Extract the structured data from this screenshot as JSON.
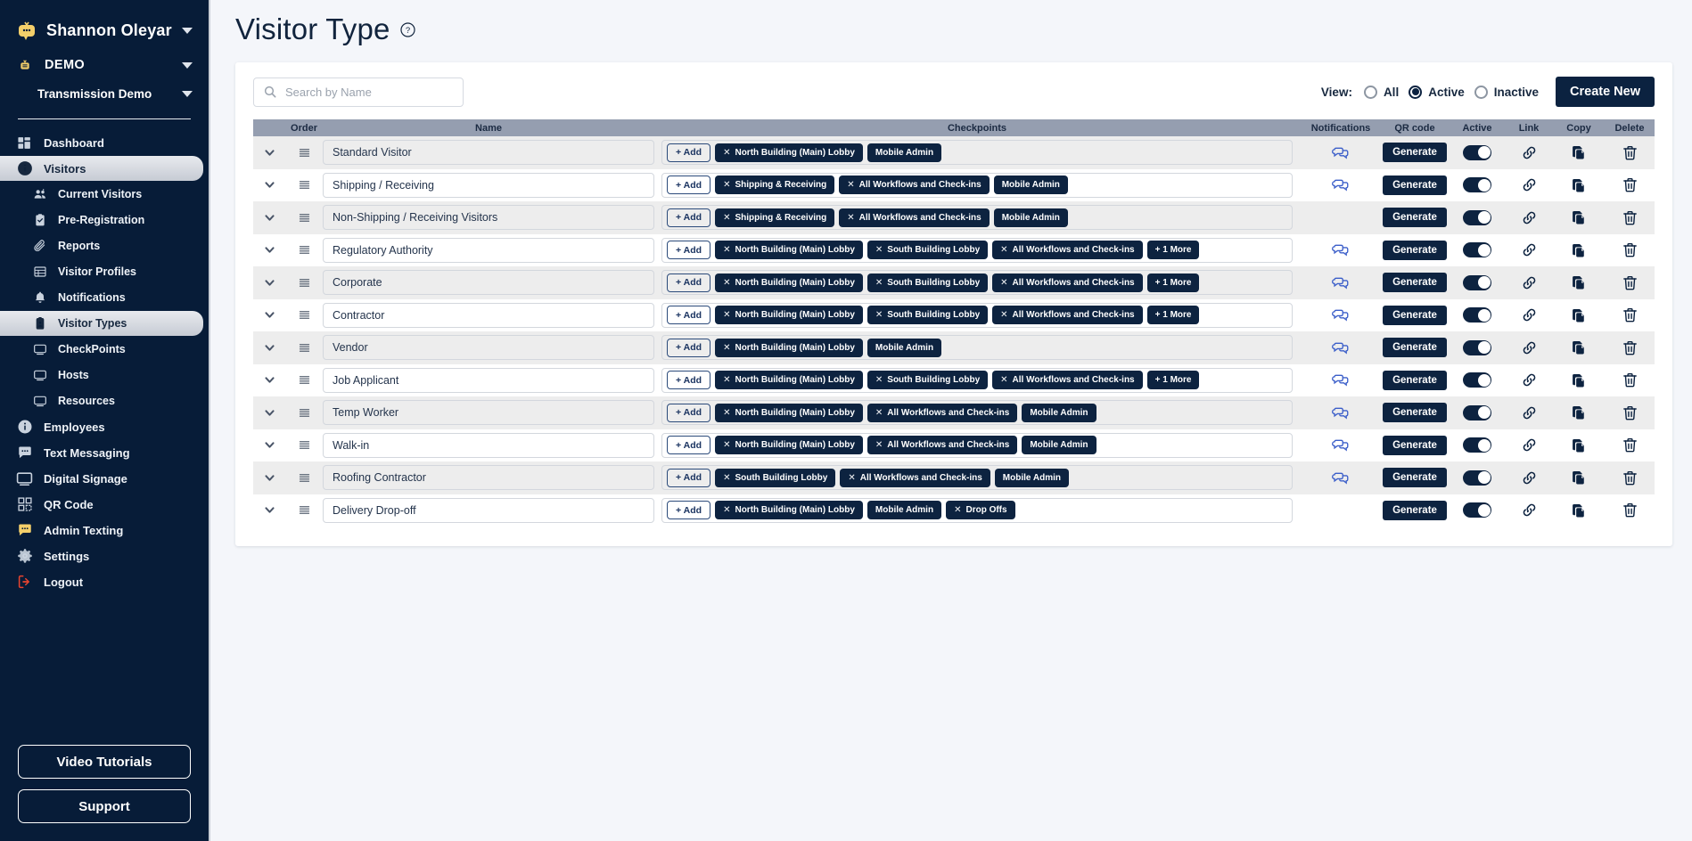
{
  "sidebar": {
    "user": {
      "name": "Shannon Oleyar",
      "icon": "tv-chat-logo-icon",
      "caret": "chevron-down-icon"
    },
    "org": {
      "name": "DEMO",
      "icon": "tv-small-icon"
    },
    "sub_org": {
      "name": "Transmission Demo"
    },
    "items": [
      {
        "label": "Dashboard",
        "icon": "dashboard-icon",
        "level": "top",
        "active": false
      },
      {
        "label": "Visitors",
        "icon": "info-circle-icon",
        "level": "top",
        "active": true
      },
      {
        "label": "Current Visitors",
        "icon": "people-icon",
        "level": "sub",
        "active": false
      },
      {
        "label": "Pre-Registration",
        "icon": "clipboard-check-icon",
        "level": "sub",
        "active": false
      },
      {
        "label": "Reports",
        "icon": "paperclip-icon",
        "level": "sub",
        "active": false
      },
      {
        "label": "Visitor Profiles",
        "icon": "table-icon",
        "level": "sub",
        "active": false
      },
      {
        "label": "Notifications",
        "icon": "bell-icon",
        "level": "sub",
        "active": false
      },
      {
        "label": "Visitor Types",
        "icon": "badge-icon",
        "level": "sub",
        "active": true
      },
      {
        "label": "CheckPoints",
        "icon": "monitor-icon",
        "level": "sub",
        "active": false
      },
      {
        "label": "Hosts",
        "icon": "monitor-icon",
        "level": "sub",
        "active": false
      },
      {
        "label": "Resources",
        "icon": "monitor-icon",
        "level": "sub",
        "active": false
      },
      {
        "label": "Employees",
        "icon": "info-circle-icon",
        "level": "top",
        "active": false
      },
      {
        "label": "Text Messaging",
        "icon": "chat-bubble-icon",
        "level": "top",
        "active": false
      },
      {
        "label": "Digital Signage",
        "icon": "monitor-large-icon",
        "level": "top",
        "active": false
      },
      {
        "label": "QR Code",
        "icon": "qr-code-icon",
        "level": "top",
        "active": false
      },
      {
        "label": "Admin Texting",
        "icon": "chat-bubble-yellow-icon",
        "level": "top",
        "active": false
      },
      {
        "label": "Settings",
        "icon": "gear-icon",
        "level": "top",
        "active": false
      },
      {
        "label": "Logout",
        "icon": "logout-icon",
        "level": "top",
        "active": false
      }
    ],
    "buttons": [
      {
        "label": "Video Tutorials"
      },
      {
        "label": "Support"
      }
    ]
  },
  "header": {
    "title": "Visitor Type",
    "help_icon": "question-circle-icon"
  },
  "search": {
    "placeholder": "Search by Name",
    "value": "",
    "icon": "search-icon"
  },
  "view": {
    "label": "View:",
    "options": [
      {
        "label": "All",
        "selected": false
      },
      {
        "label": "Active",
        "selected": true
      },
      {
        "label": "Inactive",
        "selected": false
      }
    ],
    "create_button": "Create New"
  },
  "table": {
    "columns": [
      "Order",
      "Name",
      "Checkpoints",
      "Notifications",
      "QR code",
      "Active",
      "Link",
      "Copy",
      "Delete"
    ],
    "add_chip_label": "+ Add",
    "generate_label": "Generate",
    "icons": {
      "expand": "chevron-down-icon",
      "drag": "drag-handle-icon",
      "notification": "notification-bubbles-icon",
      "link": "link-icon",
      "copy": "copy-icon",
      "delete": "trash-icon"
    },
    "rows": [
      {
        "name": "Standard Visitor",
        "checkpoints": [
          {
            "label": "North Building (Main) Lobby",
            "removable": true
          },
          {
            "label": "Mobile Admin",
            "removable": false
          }
        ],
        "notifications": true,
        "active": true
      },
      {
        "name": "Shipping / Receiving",
        "checkpoints": [
          {
            "label": "Shipping & Receiving",
            "removable": true
          },
          {
            "label": "All Workflows and Check-ins",
            "removable": true
          },
          {
            "label": "Mobile Admin",
            "removable": false
          }
        ],
        "notifications": true,
        "active": true
      },
      {
        "name": "Non-Shipping / Receiving Visitors",
        "checkpoints": [
          {
            "label": "Shipping & Receiving",
            "removable": true
          },
          {
            "label": "All Workflows and Check-ins",
            "removable": true
          },
          {
            "label": "Mobile Admin",
            "removable": false
          }
        ],
        "notifications": false,
        "active": true
      },
      {
        "name": "Regulatory Authority",
        "checkpoints": [
          {
            "label": "North Building (Main) Lobby",
            "removable": true
          },
          {
            "label": "South Building Lobby",
            "removable": true
          },
          {
            "label": "All Workflows and Check-ins",
            "removable": true
          },
          {
            "label": "+ 1 More",
            "removable": false
          }
        ],
        "notifications": true,
        "active": true
      },
      {
        "name": "Corporate",
        "checkpoints": [
          {
            "label": "North Building (Main) Lobby",
            "removable": true
          },
          {
            "label": "South Building Lobby",
            "removable": true
          },
          {
            "label": "All Workflows and Check-ins",
            "removable": true
          },
          {
            "label": "+ 1 More",
            "removable": false
          }
        ],
        "notifications": true,
        "active": true
      },
      {
        "name": "Contractor",
        "checkpoints": [
          {
            "label": "North Building (Main) Lobby",
            "removable": true
          },
          {
            "label": "South Building Lobby",
            "removable": true
          },
          {
            "label": "All Workflows and Check-ins",
            "removable": true
          },
          {
            "label": "+ 1 More",
            "removable": false
          }
        ],
        "notifications": true,
        "active": true
      },
      {
        "name": "Vendor",
        "checkpoints": [
          {
            "label": "North Building (Main) Lobby",
            "removable": true
          },
          {
            "label": "Mobile Admin",
            "removable": false
          }
        ],
        "notifications": true,
        "active": true
      },
      {
        "name": "Job Applicant",
        "checkpoints": [
          {
            "label": "North Building (Main) Lobby",
            "removable": true
          },
          {
            "label": "South Building Lobby",
            "removable": true
          },
          {
            "label": "All Workflows and Check-ins",
            "removable": true
          },
          {
            "label": "+ 1 More",
            "removable": false
          }
        ],
        "notifications": true,
        "active": true
      },
      {
        "name": "Temp Worker",
        "checkpoints": [
          {
            "label": "North Building (Main) Lobby",
            "removable": true
          },
          {
            "label": "All Workflows and Check-ins",
            "removable": true
          },
          {
            "label": "Mobile Admin",
            "removable": false
          }
        ],
        "notifications": true,
        "active": true
      },
      {
        "name": "Walk-in",
        "checkpoints": [
          {
            "label": "North Building (Main) Lobby",
            "removable": true
          },
          {
            "label": "All Workflows and Check-ins",
            "removable": true
          },
          {
            "label": "Mobile Admin",
            "removable": false
          }
        ],
        "notifications": true,
        "active": true
      },
      {
        "name": "Roofing Contractor",
        "checkpoints": [
          {
            "label": "South Building Lobby",
            "removable": true
          },
          {
            "label": "All Workflows and Check-ins",
            "removable": true
          },
          {
            "label": "Mobile Admin",
            "removable": false
          }
        ],
        "notifications": true,
        "active": true
      },
      {
        "name": "Delivery Drop-off",
        "checkpoints": [
          {
            "label": "North Building (Main) Lobby",
            "removable": true
          },
          {
            "label": "Mobile Admin",
            "removable": false
          },
          {
            "label": "Drop Offs",
            "removable": true
          }
        ],
        "notifications": false,
        "active": true
      }
    ]
  },
  "colors": {
    "sidebar_bg": "#071c38",
    "accent_navy": "#0d2340",
    "brand_yellow": "#f4cf6a",
    "header_row": "#959eb0",
    "row_alt": "#ededed",
    "page_bg": "#f4f6fa",
    "logout_red": "#e8442f",
    "notif_blue": "#3b5ec9"
  }
}
